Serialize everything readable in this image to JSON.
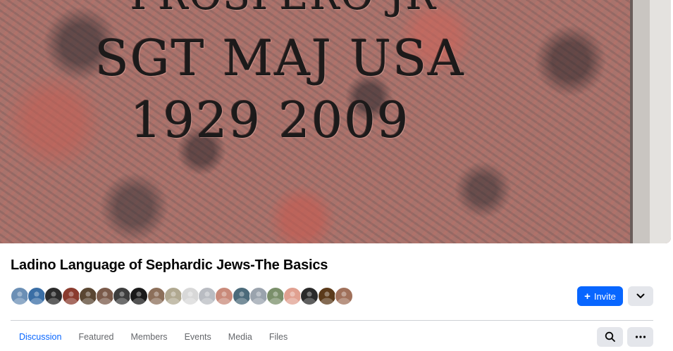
{
  "cover": {
    "engraving_lines": [
      "PROSPERO JR",
      "SGT MAJ   USA",
      "1929     2009"
    ]
  },
  "group": {
    "title": "Ladino Language of Sephardic Jews-The Basics"
  },
  "members": {
    "avatar_colors": [
      "#6b8fb5",
      "#3a6ea5",
      "#2b2b2b",
      "#8a3b2e",
      "#5a4632",
      "#7a5a4a",
      "#3d3d3d",
      "#1a1a1a",
      "#8c6f5a",
      "#b0a890",
      "#d8d8d8",
      "#b9bcc2",
      "#c98a7a",
      "#4b6a7a",
      "#9aa3ad",
      "#7a8f6a",
      "#e0a090",
      "#2a2a2a",
      "#5b3a1a",
      "#a0705a"
    ]
  },
  "actions": {
    "invite_label": "Invite",
    "invite_icon": "plus-icon",
    "more_icon": "chevron-down-icon",
    "accent": "#0866ff"
  },
  "tabs": [
    {
      "label": "Discussion",
      "active": true
    },
    {
      "label": "Featured"
    },
    {
      "label": "Members"
    },
    {
      "label": "Events"
    },
    {
      "label": "Media"
    },
    {
      "label": "Files"
    }
  ],
  "tab_actions": {
    "search_icon": "search-icon",
    "more_icon": "more-horizontal-icon"
  }
}
